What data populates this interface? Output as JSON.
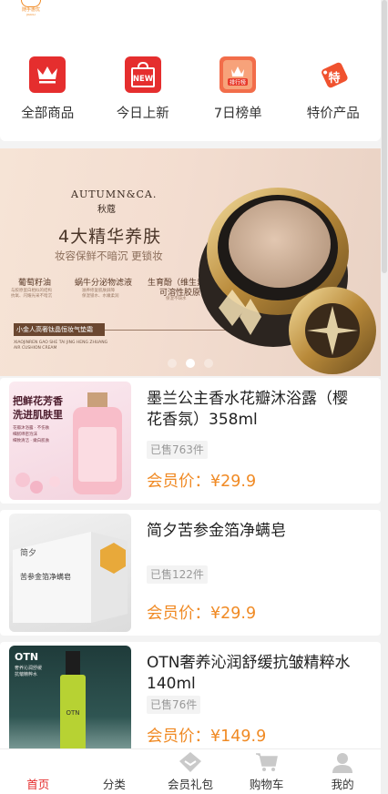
{
  "header": {
    "logo_text": "随手惠优",
    "logo_sub": "JOACLI"
  },
  "categories": [
    {
      "label": "全部商品",
      "icon": "crown-icon"
    },
    {
      "label": "今日上新",
      "icon": "new-bag-icon",
      "icon_text": "NEW"
    },
    {
      "label": "7日榜单",
      "icon": "ranking-icon",
      "icon_text": "排行榜"
    },
    {
      "label": "特价产品",
      "icon": "special-tag-icon",
      "icon_text": "特"
    }
  ],
  "banner": {
    "brand": "AUTUMN&CA.",
    "brand_cn": "秋蔻",
    "title": "4大精华养肤",
    "subtitle": "妆容保鲜不暗沉 更锁妆",
    "features": [
      {
        "name": "葡萄籽油",
        "desc1": "与胶原蛋白相似的结构",
        "desc2": "抗氧、闪耀光采不暗沉"
      },
      {
        "name": "蜗牛分泌物滤液",
        "desc1": "滋养修复肌肤屏障",
        "desc2": "保湿锁水、水嫩柔润"
      },
      {
        "name": "生育酚（维生素E）",
        "name2": "可溶性胶原",
        "desc1": "保湿不缺水"
      }
    ],
    "tag": "小金人高奢钛晶恒妆气垫霜",
    "fine1": "XIAOJINREN GAO SHE TAI JING HENG ZHUANG",
    "fine2": "AIR CUSHION CREAM",
    "dots": 3,
    "active_dot": 2
  },
  "products": [
    {
      "name": "墨兰公主香水花瓣沐浴露（樱花香氛）358ml",
      "sold": "已售763件",
      "price": "会员价：¥29.9",
      "img_headline": "把鲜花芳香洗进肌肤里",
      "img_lines": [
        "花瓣沐浴露 · 不伤肤",
        "细腻绵密泡沫",
        "细致清洁 · 嫩白肌肤"
      ]
    },
    {
      "name": "简夕苦参金箔净螨皂",
      "sold": "已售122件",
      "price": "会员价：¥29.9",
      "img_headline": "苦参金箔净螨皂",
      "img_brand": "简夕"
    },
    {
      "name": "OTN奢养沁润舒缓抗皱精粹水140ml",
      "sold": "已售76件",
      "price": "会员价：¥149.9",
      "img_brand": "OTN",
      "img_lines": [
        "奢养沁润舒缓",
        "抗皱精粹水"
      ],
      "img_bottle": "OTN"
    }
  ],
  "tabbar": [
    {
      "label": "首页",
      "icon": "home-icon",
      "active": true
    },
    {
      "label": "分类",
      "icon": "category-icon",
      "active": false
    },
    {
      "label": "会员礼包",
      "icon": "gift-diamond-icon",
      "active": false
    },
    {
      "label": "购物车",
      "icon": "cart-icon",
      "active": false
    },
    {
      "label": "我的",
      "icon": "profile-icon",
      "active": false
    }
  ],
  "colors": {
    "accent": "#e52e2e",
    "price": "#f08a24",
    "banner_bg": "#f3ddd0"
  }
}
